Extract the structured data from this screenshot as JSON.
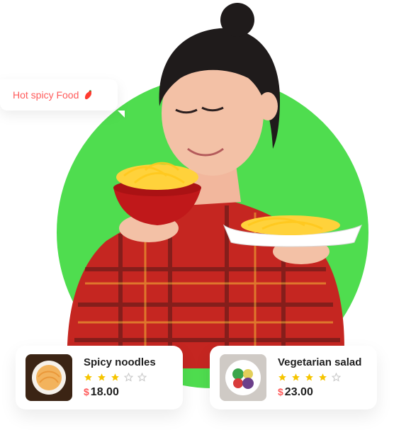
{
  "badge": {
    "text": "Hot spicy Food",
    "icon": "chili-icon"
  },
  "products": [
    {
      "name": "Spicy noodles",
      "rating": 3,
      "max_rating": 5,
      "currency": "$",
      "price": "18.00",
      "icon": "noodles-thumbnail"
    },
    {
      "name": "Vegetarian salad",
      "rating": 4,
      "max_rating": 5,
      "currency": "$",
      "price": "23.00",
      "icon": "salad-thumbnail"
    }
  ],
  "colors": {
    "accent": "#4fdd4f",
    "star": "#f6c500",
    "currency": "#ff5b5b"
  }
}
